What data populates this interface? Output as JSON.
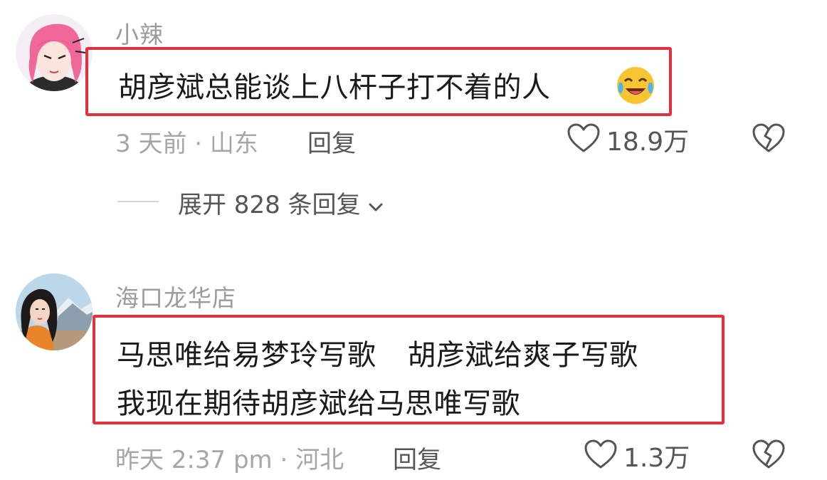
{
  "comments": [
    {
      "username": "小辣",
      "text": "胡彦斌总能谈上八杆子打不着的人",
      "emoji": "crying-laughing-emoji",
      "meta": "3 天前 · 山东",
      "reply_label": "回复",
      "likes": "18.9万",
      "expand_label": "展开 828 条回复"
    },
    {
      "username": "海口龙华店",
      "text_line1_part1": "马思唯给易梦玲写歌",
      "text_line1_part2": "胡彦斌给爽子写歌",
      "text_line2": "我现在期待胡彦斌给马思唯写歌",
      "meta": "昨天 2:37 pm · 河北",
      "reply_label": "回复",
      "likes": "1.3万"
    }
  ],
  "colors": {
    "highlight_border": "#e1313f",
    "meta_text": "#a6a6a6",
    "username_text": "#9b9b9b"
  }
}
